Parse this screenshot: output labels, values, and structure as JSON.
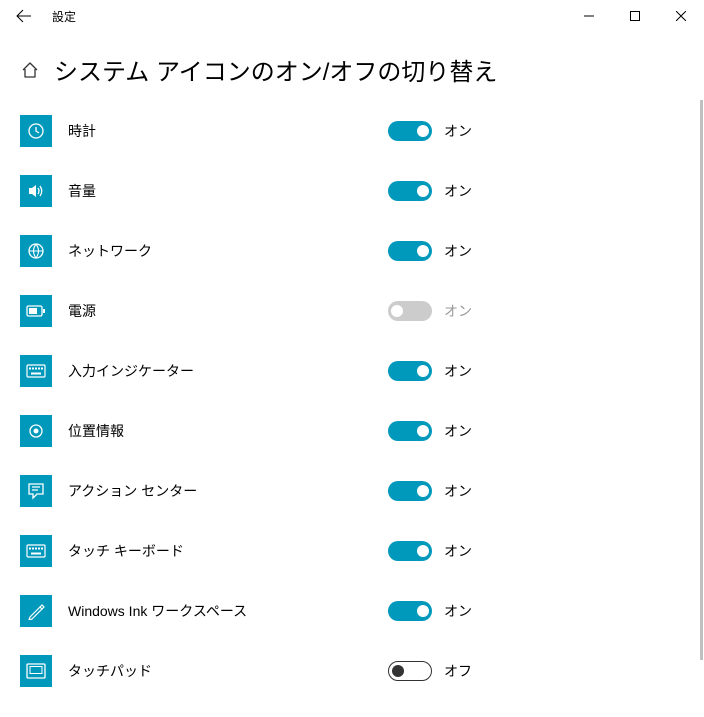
{
  "app_title": "設定",
  "page_title": "システム アイコンのオン/オフの切り替え",
  "states": {
    "on": "オン",
    "off": "オフ"
  },
  "accent": "#0099bc",
  "items": [
    {
      "id": "clock",
      "label": "時計",
      "state": "on",
      "enabled": true,
      "icon": "clock"
    },
    {
      "id": "volume",
      "label": "音量",
      "state": "on",
      "enabled": true,
      "icon": "volume"
    },
    {
      "id": "network",
      "label": "ネットワーク",
      "state": "on",
      "enabled": true,
      "icon": "network"
    },
    {
      "id": "power",
      "label": "電源",
      "state": "on",
      "enabled": false,
      "icon": "power"
    },
    {
      "id": "input-indicator",
      "label": "入力インジケーター",
      "state": "on",
      "enabled": true,
      "icon": "keyboard"
    },
    {
      "id": "location",
      "label": "位置情報",
      "state": "on",
      "enabled": true,
      "icon": "location"
    },
    {
      "id": "action-center",
      "label": "アクション センター",
      "state": "on",
      "enabled": true,
      "icon": "action-center"
    },
    {
      "id": "touch-keyboard",
      "label": "タッチ キーボード",
      "state": "on",
      "enabled": true,
      "icon": "keyboard"
    },
    {
      "id": "windows-ink",
      "label": "Windows Ink ワークスペース",
      "state": "on",
      "enabled": true,
      "icon": "ink"
    },
    {
      "id": "touchpad",
      "label": "タッチパッド",
      "state": "off",
      "enabled": true,
      "icon": "touchpad"
    }
  ]
}
